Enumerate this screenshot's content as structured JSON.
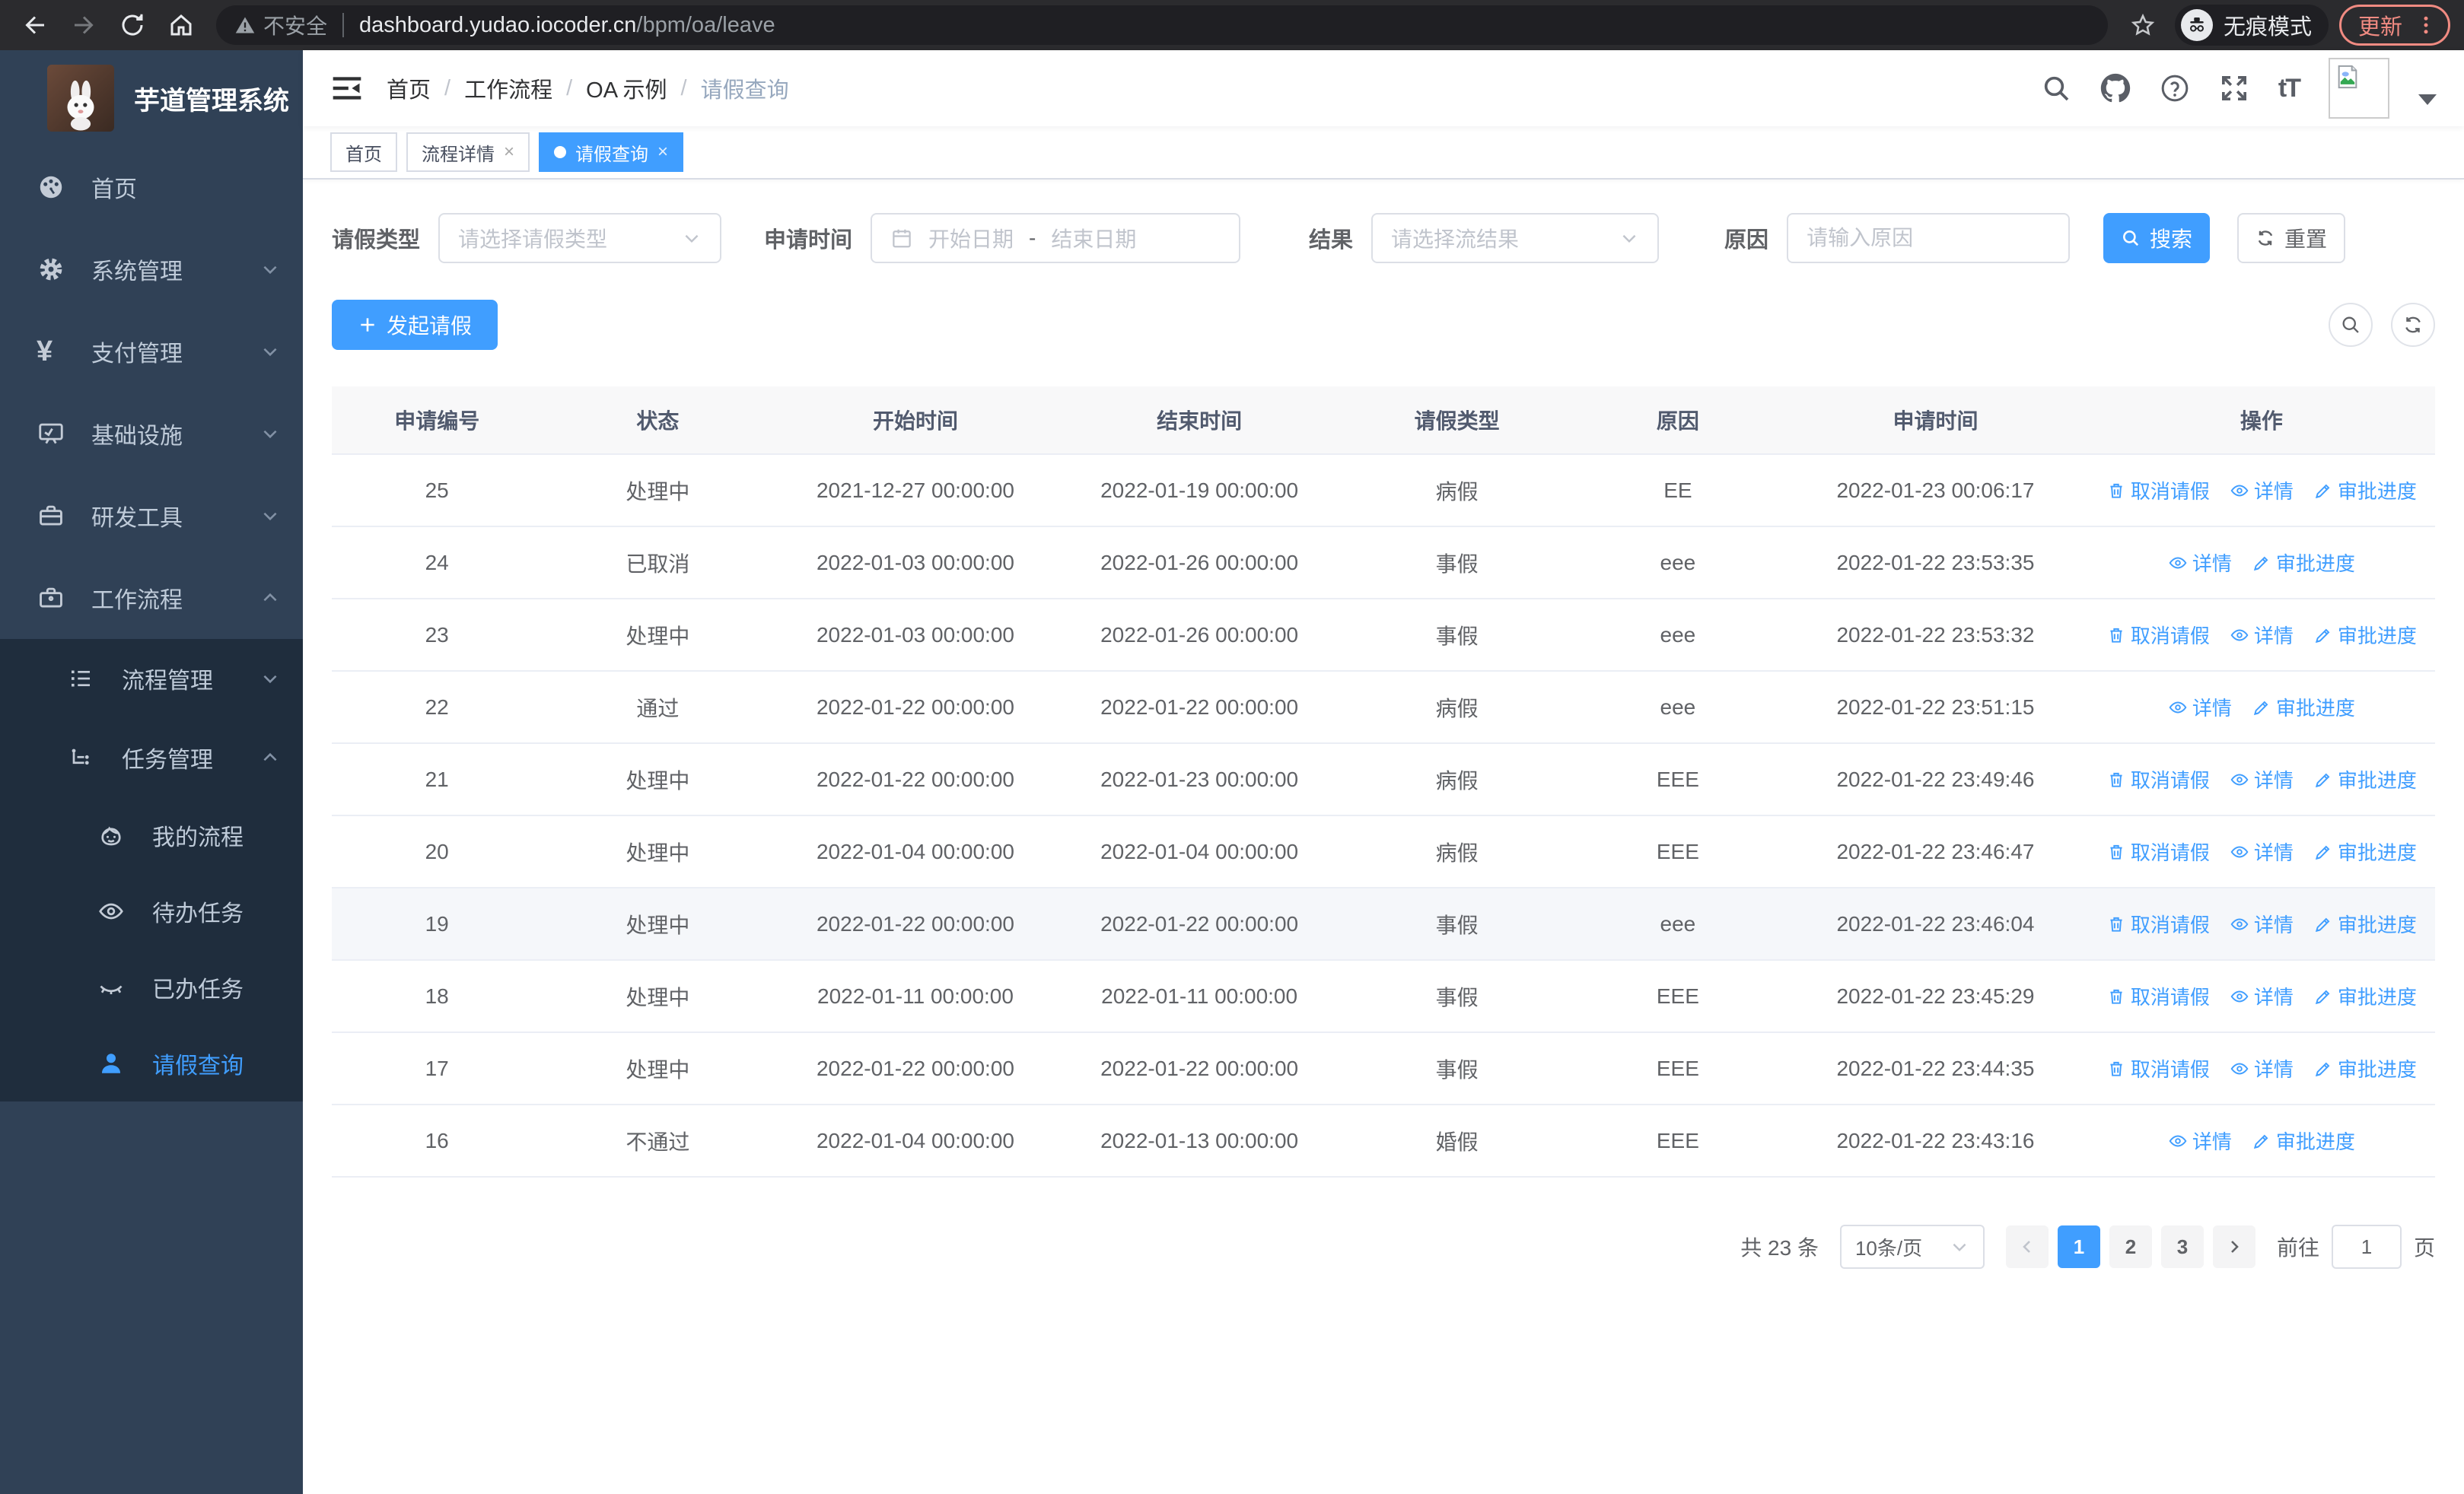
{
  "colors": {
    "primary": "#409eff",
    "sidebar_bg": "#304156",
    "sidebar_sub_bg": "#1f2d3d",
    "update_accent": "#f18b82"
  },
  "browser": {
    "security_label": "不安全",
    "url_host": "dashboard.yudao.iocoder.cn",
    "url_path": "/bpm/oa/leave",
    "incognito_label": "无痕模式",
    "update_label": "更新"
  },
  "icons": {
    "yen": "¥",
    "font_size": "tT",
    "question": "?",
    "close": "×"
  },
  "sidebar": {
    "title": "芋道管理系统",
    "home": "首页",
    "system": "系统管理",
    "payment": "支付管理",
    "infra": "基础设施",
    "devtools": "研发工具",
    "workflow": "工作流程",
    "process_mgmt": "流程管理",
    "task_mgmt": "任务管理",
    "my_process": "我的流程",
    "todo_tasks": "待办任务",
    "done_tasks": "已办任务",
    "leave_query": "请假查询"
  },
  "breadcrumb": {
    "separator": "/",
    "items": [
      "首页",
      "工作流程",
      "OA 示例",
      "请假查询"
    ]
  },
  "tabs": [
    {
      "label": "首页"
    },
    {
      "label": "流程详情"
    },
    {
      "label": "请假查询"
    }
  ],
  "filters": {
    "leave_type_label": "请假类型",
    "leave_type_placeholder": "请选择请假类型",
    "apply_time_label": "申请时间",
    "start_date_placeholder": "开始日期",
    "range_separator": "-",
    "end_date_placeholder": "结束日期",
    "result_label": "结果",
    "result_placeholder": "请选择流结果",
    "reason_label": "原因",
    "reason_placeholder": "请输入原因",
    "search_label": "搜索",
    "reset_label": "重置"
  },
  "toolbar": {
    "create_label": "发起请假"
  },
  "table": {
    "columns": [
      "申请编号",
      "状态",
      "开始时间",
      "结束时间",
      "请假类型",
      "原因",
      "申请时间",
      "操作"
    ],
    "action_labels": {
      "cancel": "取消请假",
      "detail": "详情",
      "progress": "审批进度"
    },
    "rows": [
      {
        "id": "25",
        "status": "处理中",
        "start": "2021-12-27 00:00:00",
        "end": "2022-01-19 00:00:00",
        "type": "病假",
        "reason": "EE",
        "applied": "2022-01-23 00:06:17",
        "cancellable": true,
        "highlight": false
      },
      {
        "id": "24",
        "status": "已取消",
        "start": "2022-01-03 00:00:00",
        "end": "2022-01-26 00:00:00",
        "type": "事假",
        "reason": "eee",
        "applied": "2022-01-22 23:53:35",
        "cancellable": false,
        "highlight": false
      },
      {
        "id": "23",
        "status": "处理中",
        "start": "2022-01-03 00:00:00",
        "end": "2022-01-26 00:00:00",
        "type": "事假",
        "reason": "eee",
        "applied": "2022-01-22 23:53:32",
        "cancellable": true,
        "highlight": false
      },
      {
        "id": "22",
        "status": "通过",
        "start": "2022-01-22 00:00:00",
        "end": "2022-01-22 00:00:00",
        "type": "病假",
        "reason": "eee",
        "applied": "2022-01-22 23:51:15",
        "cancellable": false,
        "highlight": false
      },
      {
        "id": "21",
        "status": "处理中",
        "start": "2022-01-22 00:00:00",
        "end": "2022-01-23 00:00:00",
        "type": "病假",
        "reason": "EEE",
        "applied": "2022-01-22 23:49:46",
        "cancellable": true,
        "highlight": false
      },
      {
        "id": "20",
        "status": "处理中",
        "start": "2022-01-04 00:00:00",
        "end": "2022-01-04 00:00:00",
        "type": "病假",
        "reason": "EEE",
        "applied": "2022-01-22 23:46:47",
        "cancellable": true,
        "highlight": false
      },
      {
        "id": "19",
        "status": "处理中",
        "start": "2022-01-22 00:00:00",
        "end": "2022-01-22 00:00:00",
        "type": "事假",
        "reason": "eee",
        "applied": "2022-01-22 23:46:04",
        "cancellable": true,
        "highlight": true
      },
      {
        "id": "18",
        "status": "处理中",
        "start": "2022-01-11 00:00:00",
        "end": "2022-01-11 00:00:00",
        "type": "事假",
        "reason": "EEE",
        "applied": "2022-01-22 23:45:29",
        "cancellable": true,
        "highlight": false
      },
      {
        "id": "17",
        "status": "处理中",
        "start": "2022-01-22 00:00:00",
        "end": "2022-01-22 00:00:00",
        "type": "事假",
        "reason": "EEE",
        "applied": "2022-01-22 23:44:35",
        "cancellable": true,
        "highlight": false
      },
      {
        "id": "16",
        "status": "不通过",
        "start": "2022-01-04 00:00:00",
        "end": "2022-01-13 00:00:00",
        "type": "婚假",
        "reason": "EEE",
        "applied": "2022-01-22 23:43:16",
        "cancellable": false,
        "highlight": false
      }
    ]
  },
  "pagination": {
    "total_text": "共 23 条",
    "page_size": "10条/页",
    "pages": [
      "1",
      "2",
      "3"
    ],
    "goto_label": "前往",
    "goto_value": "1",
    "page_suffix": "页"
  }
}
